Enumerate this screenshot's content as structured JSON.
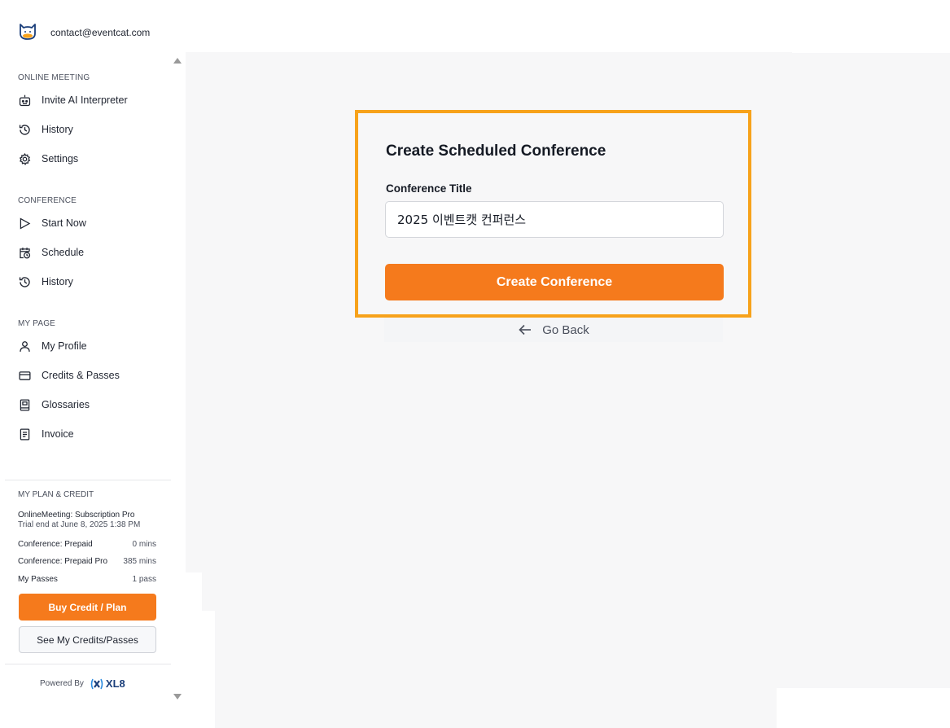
{
  "header": {
    "logo_icon": "cat-logo-icon",
    "email": "contact@eventcat.com"
  },
  "sidebar": {
    "sections": [
      {
        "title": "ONLINE MEETING",
        "items": [
          {
            "label": "Invite AI Interpreter",
            "icon": "robot-icon"
          },
          {
            "label": "History",
            "icon": "history-icon"
          },
          {
            "label": "Settings",
            "icon": "gear-icon"
          }
        ]
      },
      {
        "title": "CONFERENCE",
        "items": [
          {
            "label": "Start Now",
            "icon": "play-icon"
          },
          {
            "label": "Schedule",
            "icon": "calendar-clock-icon"
          },
          {
            "label": "History",
            "icon": "history-icon"
          }
        ]
      },
      {
        "title": "MY PAGE",
        "items": [
          {
            "label": "My Profile",
            "icon": "user-icon"
          },
          {
            "label": "Credits & Passes",
            "icon": "card-icon"
          },
          {
            "label": "Glossaries",
            "icon": "book-icon"
          },
          {
            "label": "Invoice",
            "icon": "document-icon"
          }
        ]
      }
    ],
    "plan": {
      "title": "MY PLAN & CREDIT",
      "subscription_line1": "OnlineMeeting: Subscription Pro",
      "subscription_line2": "Trial end at June 8, 2025 1:38 PM",
      "rows": [
        {
          "label": "Conference: Prepaid",
          "value": "0 mins"
        },
        {
          "label": "Conference: Prepaid Pro",
          "value": "385 mins"
        },
        {
          "label": "My Passes",
          "value": "1 pass"
        }
      ],
      "buy_button": "Buy Credit / Plan",
      "see_button": "See My Credits/Passes"
    },
    "powered_by": "Powered By",
    "brand": "XL8"
  },
  "main": {
    "card_title": "Create Scheduled Conference",
    "field_label": "Conference Title",
    "field_value": "2025 이벤트캣 컨퍼런스",
    "create_button": "Create Conference",
    "go_back": "Go Back"
  },
  "colors": {
    "accent": "#f57a1c",
    "highlight_border": "#f7a21b",
    "brand_blue": "#1a3e7a"
  }
}
